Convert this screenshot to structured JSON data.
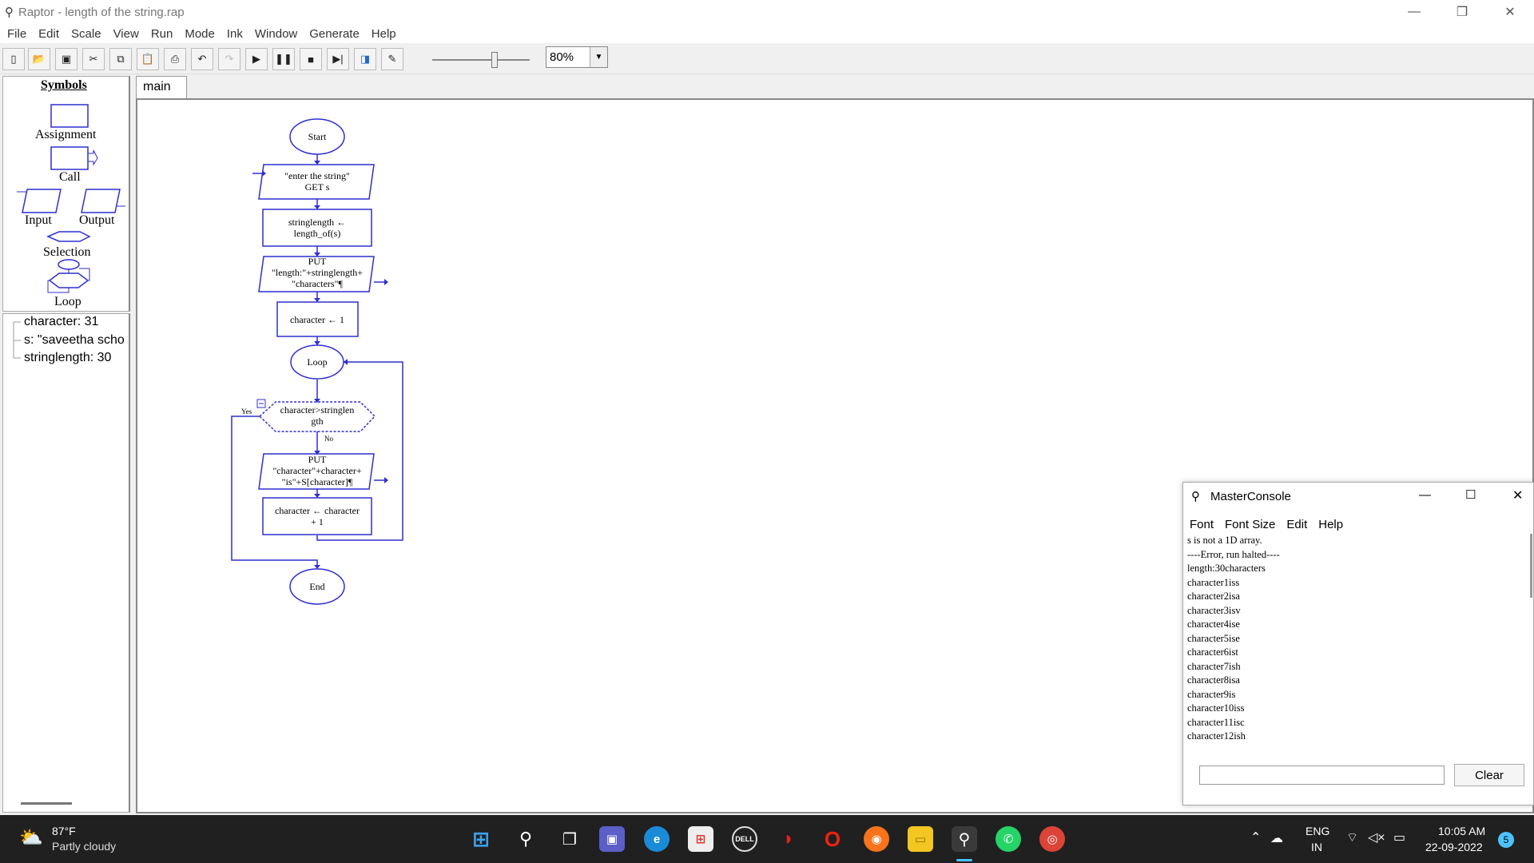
{
  "window": {
    "title": "Raptor - length of the string.rap",
    "controls": {
      "minimize": "—",
      "restore": "❐",
      "close": "✕"
    }
  },
  "menu": [
    "File",
    "Edit",
    "Scale",
    "View",
    "Run",
    "Mode",
    "Ink",
    "Window",
    "Generate",
    "Help"
  ],
  "toolbar": {
    "zoom": "80%"
  },
  "symbols": {
    "header": "Symbols",
    "assignment": "Assignment",
    "call": "Call",
    "input": "Input",
    "output": "Output",
    "selection": "Selection",
    "loop": "Loop"
  },
  "variables": [
    "character: 31",
    "s: \"saveetha scho",
    "stringlength: 30"
  ],
  "tabs": {
    "main": "main"
  },
  "flowchart": {
    "start": "Start",
    "input_line1": "\"enter the string\"",
    "input_line2": "GET s",
    "assign1_line1": "stringlength ←",
    "assign1_line2": "length_of(s)",
    "output1_line1": "PUT",
    "output1_line2": "\"length:\"+stringlength+",
    "output1_line3": "\"characters\"¶",
    "assign2": "character ← 1",
    "loop": "Loop",
    "yes": "Yes",
    "condition_line1": "character>stringlen",
    "condition_line2": "gth",
    "no": "No",
    "output2_line1": "PUT",
    "output2_line2": "\"character\"+character+",
    "output2_line3": "\"is\"+S[character]¶",
    "assign3_line1": "character ← character",
    "assign3_line2": "+ 1",
    "end": "End"
  },
  "console": {
    "title": "MasterConsole",
    "menu": [
      "Font",
      "Font Size",
      "Edit",
      "Help"
    ],
    "lines": [
      "s is not a 1D array.",
      "----Error, run halted----",
      "length:30characters",
      "character1iss",
      "character2isa",
      "character3isv",
      "character4ise",
      "character5ise",
      "character6ist",
      "character7ish",
      "character8isa",
      "character9is",
      "character10iss",
      "character11isc",
      "character12ish"
    ],
    "input_value": "",
    "clear_label": "Clear"
  },
  "taskbar": {
    "weather_temp": "87°F",
    "weather_desc": "Partly cloudy",
    "lang_top": "ENG",
    "lang_bottom": "IN",
    "time": "10:05 AM",
    "date": "22-09-2022",
    "notification_count": "5"
  },
  "colors": {
    "flow_stroke": "#2f2fd0",
    "accent": "#0078d4"
  }
}
